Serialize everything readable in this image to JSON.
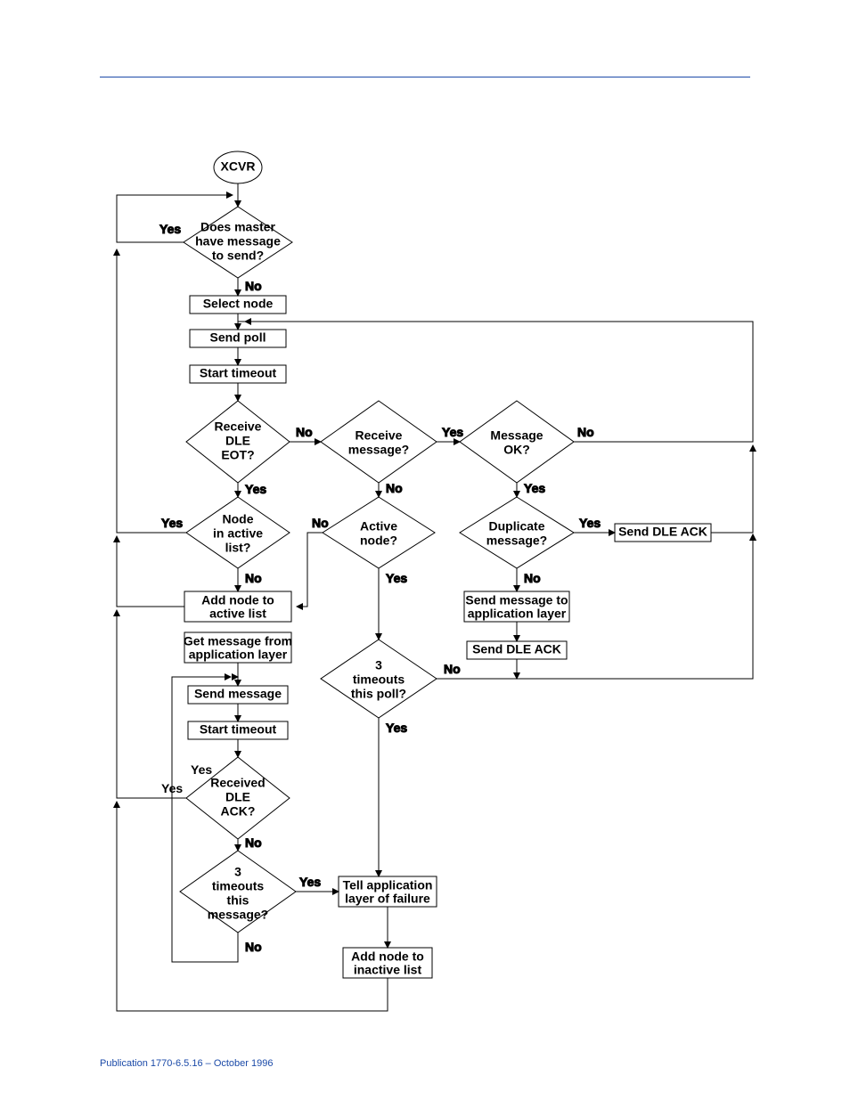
{
  "footer": "Publication 1770-6.5.16 – October 1996",
  "start": "XCVR",
  "d": {
    "msgToSend": "Does master have message to send?",
    "recvDleEot": "Receive DLE EOT?",
    "recvMsg": "Receive message?",
    "msgOk": "Message OK?",
    "nodeInActive": "Node in active list?",
    "activeNode": "Active node?",
    "dupMsg": "Duplicate message?",
    "threeTimeoutsPoll": "3 timeouts this poll?",
    "recvDleAck": "Received DLE ACK?",
    "threeTimeoutsMsg": "3 timeouts this message?"
  },
  "p": {
    "selectNode": "Select node",
    "sendPoll": "Send poll",
    "startTimeout1": "Start timeout",
    "addNodeActive": "Add node to active list",
    "getMsgApp": "Get message from application layer",
    "sendMsg": "Send message",
    "startTimeout2": "Start timeout",
    "sendMsgApp": "Send message to application layer",
    "sendDleAck1": "Send DLE ACK",
    "sendDleAck2": "Send DLE ACK",
    "tellFail": "Tell application layer of failure",
    "addNodeInactive": "Add node to inactive list"
  },
  "l": {
    "yes": "Yes",
    "no": "No"
  }
}
